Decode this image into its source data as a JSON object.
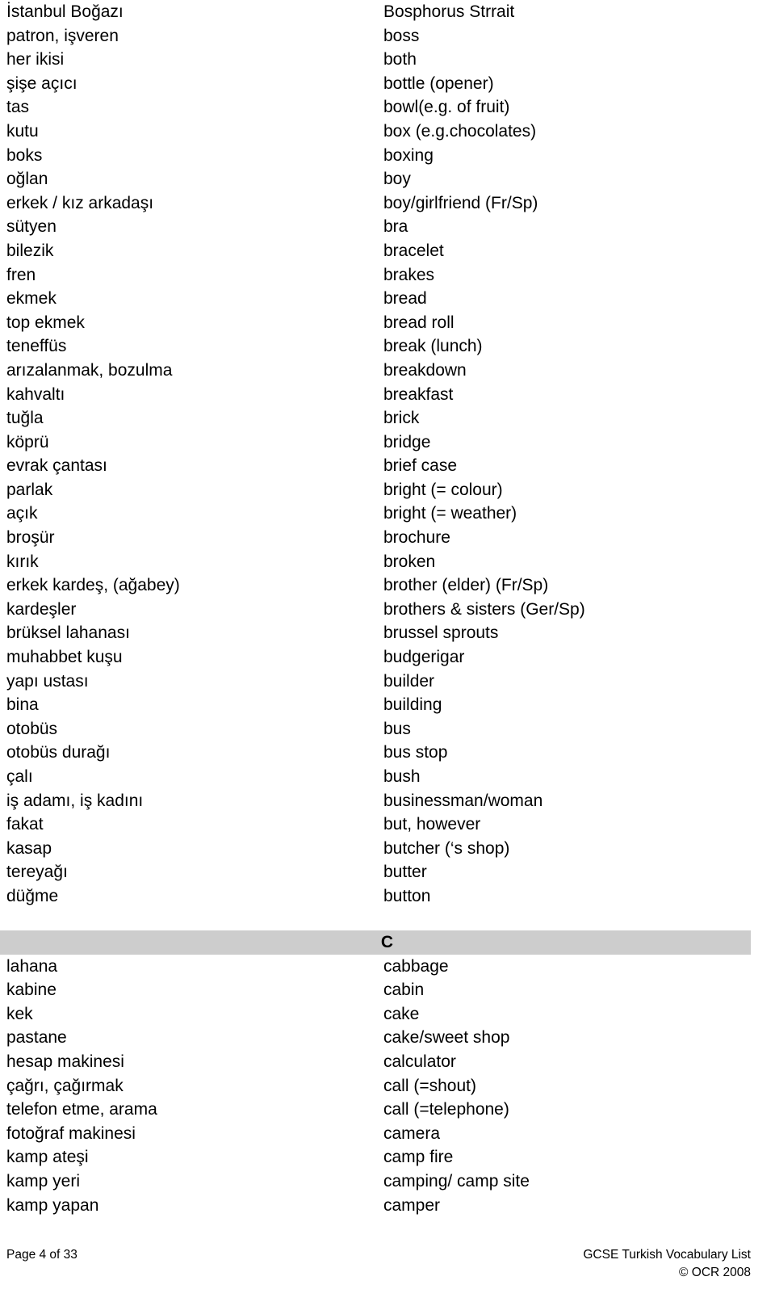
{
  "document": {
    "title": "GCSE Turkish Vocabulary List",
    "page_label": "Page 4 of 33",
    "copyright": "© OCR 2008"
  },
  "sections": [
    {
      "letter": null,
      "entries": [
        {
          "source": "İstanbul Boğazı",
          "target": "Bosphorus Strrait"
        },
        {
          "source": "patron, işveren",
          "target": "boss"
        },
        {
          "source": "her ikisi",
          "target": "both"
        },
        {
          "source": "şişe açıcı",
          "target": "bottle (opener)"
        },
        {
          "source": "tas",
          "target": "bowl(e.g. of fruit)"
        },
        {
          "source": "kutu",
          "target": "box (e.g.chocolates)"
        },
        {
          "source": "boks",
          "target": "boxing"
        },
        {
          "source": "oğlan",
          "target": "boy"
        },
        {
          "source": "erkek / kız arkadaşı",
          "target": "boy/girlfriend (Fr/Sp)"
        },
        {
          "source": "sütyen",
          "target": "bra"
        },
        {
          "source": "bilezik",
          "target": "bracelet"
        },
        {
          "source": "fren",
          "target": "brakes"
        },
        {
          "source": "ekmek",
          "target": "bread"
        },
        {
          "source": "top ekmek",
          "target": "bread roll"
        },
        {
          "source": "teneffüs",
          "target": "break (lunch)"
        },
        {
          "source": "arızalanmak, bozulma",
          "target": "breakdown"
        },
        {
          "source": "kahvaltı",
          "target": "breakfast"
        },
        {
          "source": "tuğla",
          "target": "brick"
        },
        {
          "source": "köprü",
          "target": "bridge"
        },
        {
          "source": "evrak çantası",
          "target": "brief case"
        },
        {
          "source": "parlak",
          "target": "bright (= colour)"
        },
        {
          "source": "açık",
          "target": "bright (= weather)"
        },
        {
          "source": "broşür",
          "target": "brochure"
        },
        {
          "source": "kırık",
          "target": "broken"
        },
        {
          "source": "erkek kardeş, (ağabey)",
          "target": "brother (elder) (Fr/Sp)"
        },
        {
          "source": "kardeşler",
          "target": "brothers & sisters (Ger/Sp)"
        },
        {
          "source": "brüksel lahanası",
          "target": "brussel sprouts"
        },
        {
          "source": "muhabbet kuşu",
          "target": "budgerigar"
        },
        {
          "source": "yapı ustası",
          "target": "builder"
        },
        {
          "source": "bina",
          "target": "building"
        },
        {
          "source": "otobüs",
          "target": "bus"
        },
        {
          "source": "otobüs durağı",
          "target": "bus stop"
        },
        {
          "source": "çalı",
          "target": "bush"
        },
        {
          "source": "iş adamı, iş kadını",
          "target": "businessman/woman"
        },
        {
          "source": "fakat",
          "target": "but, however"
        },
        {
          "source": "kasap",
          "target": "butcher (‘s shop)"
        },
        {
          "source": "tereyağı",
          "target": "butter"
        },
        {
          "source": "düğme",
          "target": "button"
        }
      ]
    },
    {
      "letter": "C",
      "entries": [
        {
          "source": "lahana",
          "target": "cabbage"
        },
        {
          "source": "kabine",
          "target": "cabin"
        },
        {
          "source": "kek",
          "target": "cake"
        },
        {
          "source": "pastane",
          "target": "cake/sweet shop"
        },
        {
          "source": "hesap makinesi",
          "target": "calculator"
        },
        {
          "source": "çağrı, çağırmak",
          "target": "call (=shout)"
        },
        {
          "source": "telefon etme, arama",
          "target": "call (=telephone)"
        },
        {
          "source": "fotoğraf makinesi",
          "target": "camera"
        },
        {
          "source": "kamp ateşi",
          "target": "camp fire"
        },
        {
          "source": "kamp yeri",
          "target": "camping/ camp site"
        },
        {
          "source": "kamp yapan",
          "target": "camper"
        }
      ]
    }
  ],
  "colors": {
    "section_band_background": "#cdcdcd",
    "text": "#000000",
    "page_background": "#ffffff"
  }
}
